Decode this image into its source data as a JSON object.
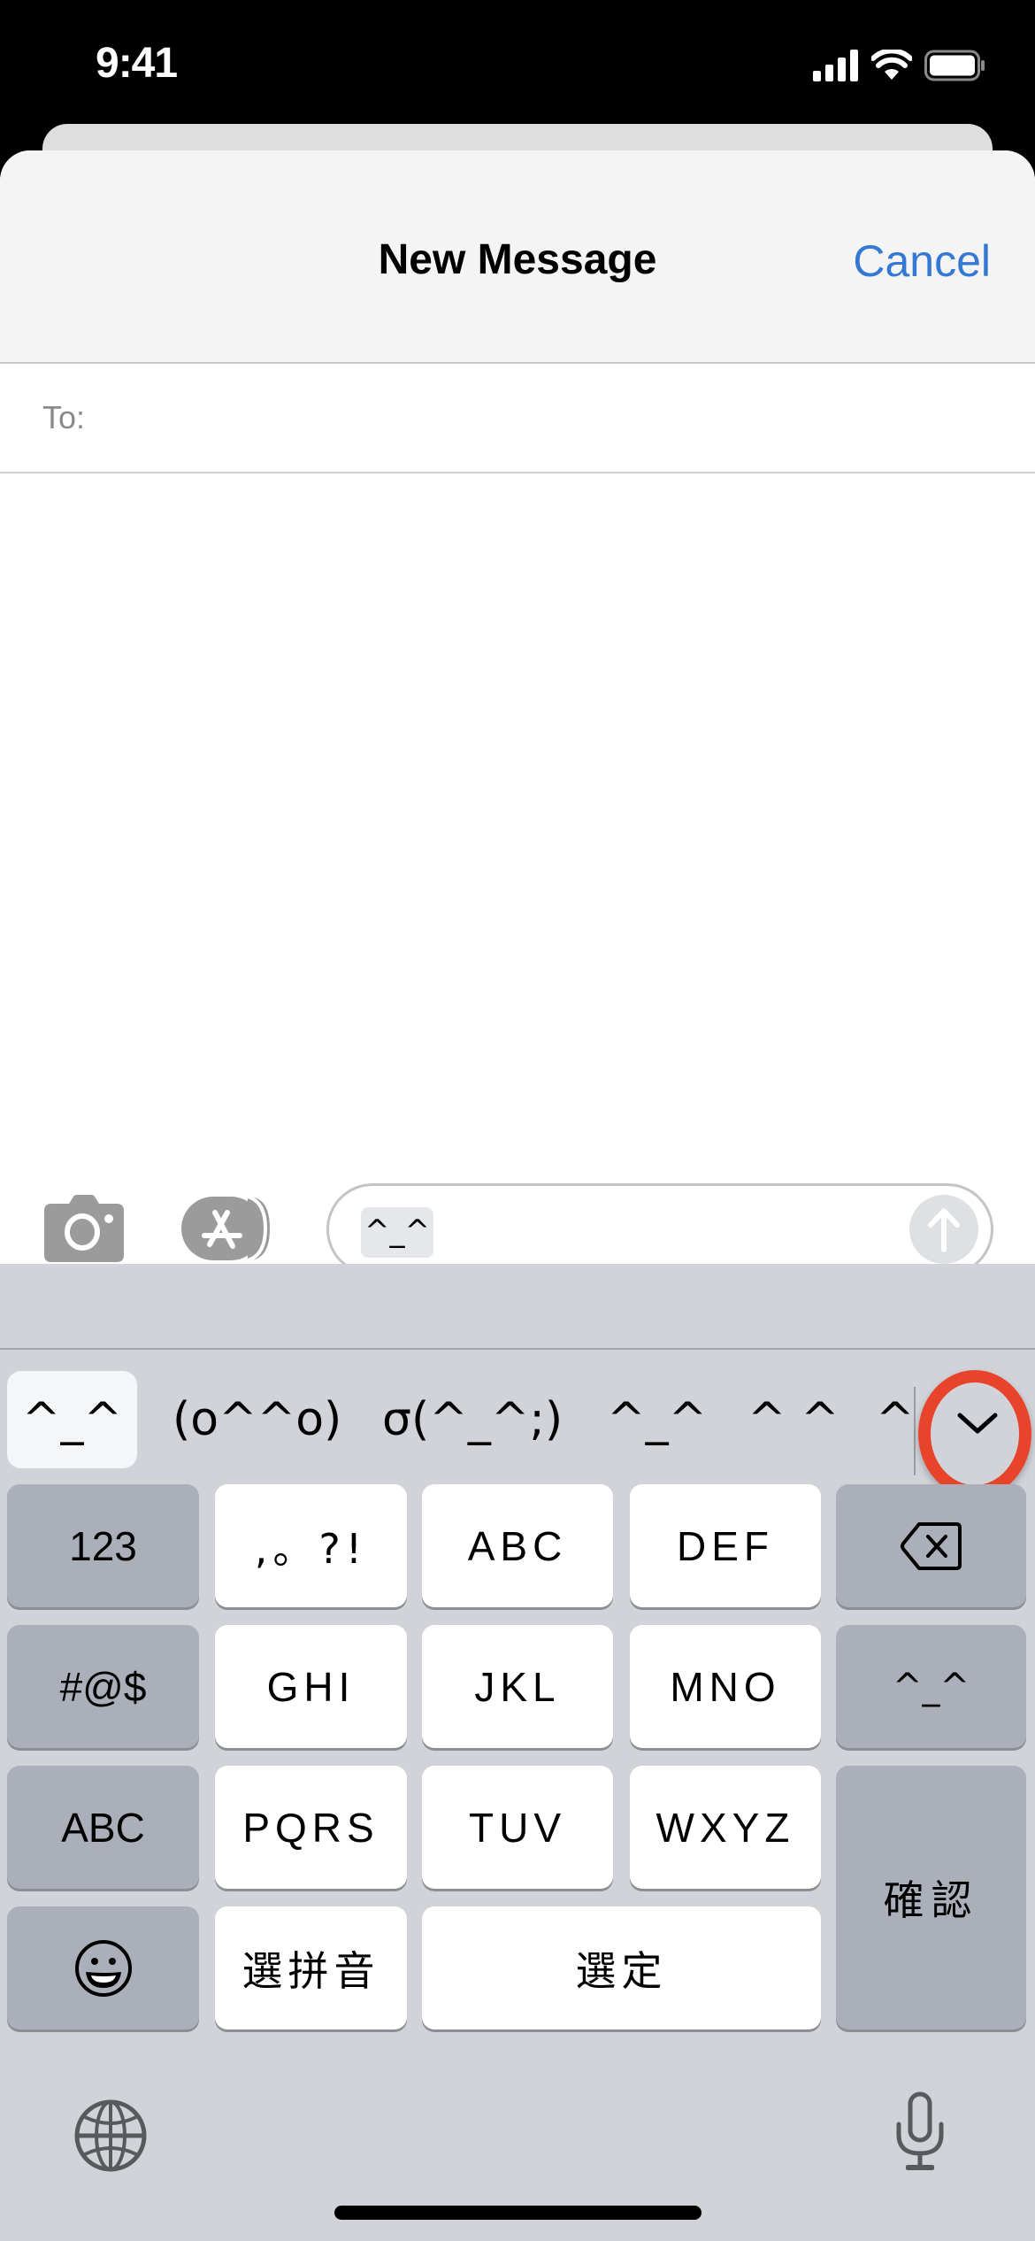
{
  "status_bar": {
    "time": "9:41",
    "icons": [
      "signal-icon",
      "wifi-icon",
      "battery-icon"
    ]
  },
  "header": {
    "title": "New Message",
    "cancel_label": "Cancel",
    "accent_color": "#3478d4"
  },
  "recipient": {
    "label": "To:",
    "value": ""
  },
  "compose": {
    "camera_icon": "camera-icon",
    "apps_icon": "app-store-icon",
    "marked_text": "^_^",
    "send_icon": "arrow-up-icon"
  },
  "keyboard": {
    "candidates": [
      {
        "label": "^_^",
        "selected": true
      },
      {
        "label": "(o^^o)",
        "selected": false
      },
      {
        "label": "σ(^_^;)",
        "selected": false
      },
      {
        "label": "^_^",
        "selected": false
      },
      {
        "label": "^ ^",
        "selected": false
      },
      {
        "label": "^",
        "selected": false
      }
    ],
    "expand_icon": "chevron-down-icon",
    "highlight_color": "#e8432b",
    "keys": {
      "numbers": "123",
      "punct": ",。?!",
      "abc": "ABC",
      "def": "DEF",
      "delete_icon": "delete-icon",
      "symbols": "#@$",
      "ghi": "GHI",
      "jkl": "JKL",
      "mno": "MNO",
      "kaomoji": "^_^",
      "abc_switch": "ABC",
      "pqrs": "PQRS",
      "tuv": "TUV",
      "wxyz": "WXYZ",
      "confirm": "確認",
      "emoji_icon": "emoji-icon",
      "select_pinyin": "選拼音",
      "select": "選定"
    },
    "globe_icon": "globe-icon",
    "mic_icon": "microphone-icon"
  }
}
